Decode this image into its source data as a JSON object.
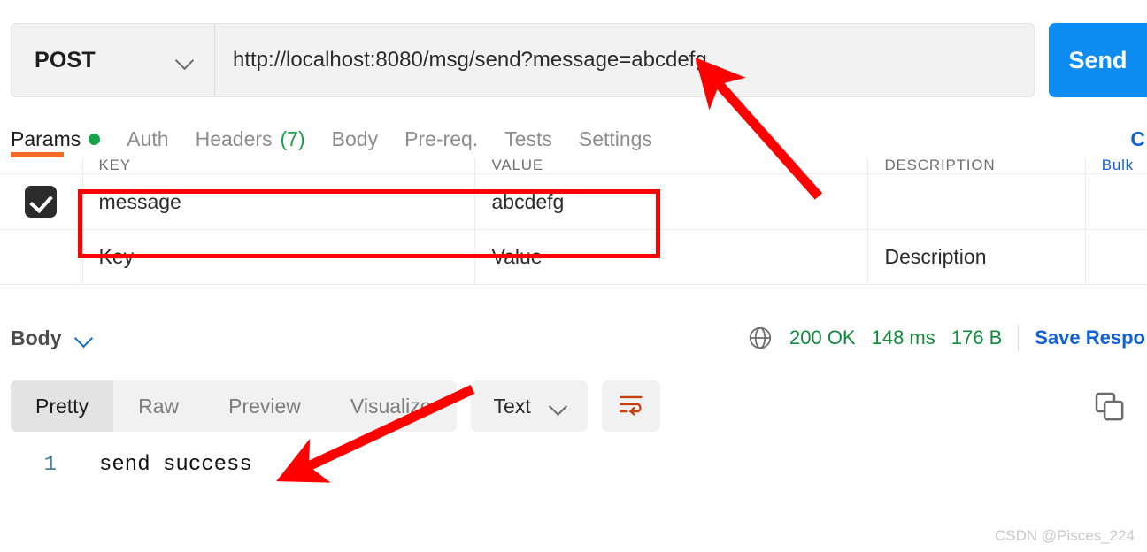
{
  "request": {
    "method": "POST",
    "url": "http://localhost:8080/msg/send?message=abcdefg",
    "send_label": "Send",
    "tabs": [
      {
        "label": "Params",
        "marker": "dot",
        "active": true
      },
      {
        "label": "Auth",
        "marker": "",
        "active": false
      },
      {
        "label": "Headers",
        "marker": "(7)",
        "active": false
      },
      {
        "label": "Body",
        "marker": "",
        "active": false
      },
      {
        "label": "Pre-req.",
        "marker": "",
        "active": false
      },
      {
        "label": "Tests",
        "marker": "",
        "active": false
      },
      {
        "label": "Settings",
        "marker": "",
        "active": false
      }
    ],
    "cookies_label": "C"
  },
  "params": {
    "columns": [
      "KEY",
      "VALUE",
      "DESCRIPTION"
    ],
    "bulk_label": "Bulk",
    "rows": [
      {
        "checked": true,
        "key": "message",
        "value": "abcdefg",
        "description": ""
      }
    ],
    "placeholders": {
      "key": "Key",
      "value": "Value",
      "description": "Description"
    }
  },
  "response": {
    "body_label": "Body",
    "status": "200 OK",
    "time": "148 ms",
    "size": "176 B",
    "save_label": "Save Respo",
    "view_tabs": [
      "Pretty",
      "Raw",
      "Preview",
      "Visualize"
    ],
    "active_view_tab": "Pretty",
    "content_type": "Text",
    "lines": [
      {
        "no": "1",
        "text": "send success"
      }
    ]
  },
  "watermark": "CSDN @Pisces_224",
  "colors": {
    "accent_blue": "#0d8cf2",
    "link_blue": "#1060d8",
    "success_green": "#128a3c",
    "orange": "#f26b2b",
    "annotation_red": "#fe0000"
  }
}
